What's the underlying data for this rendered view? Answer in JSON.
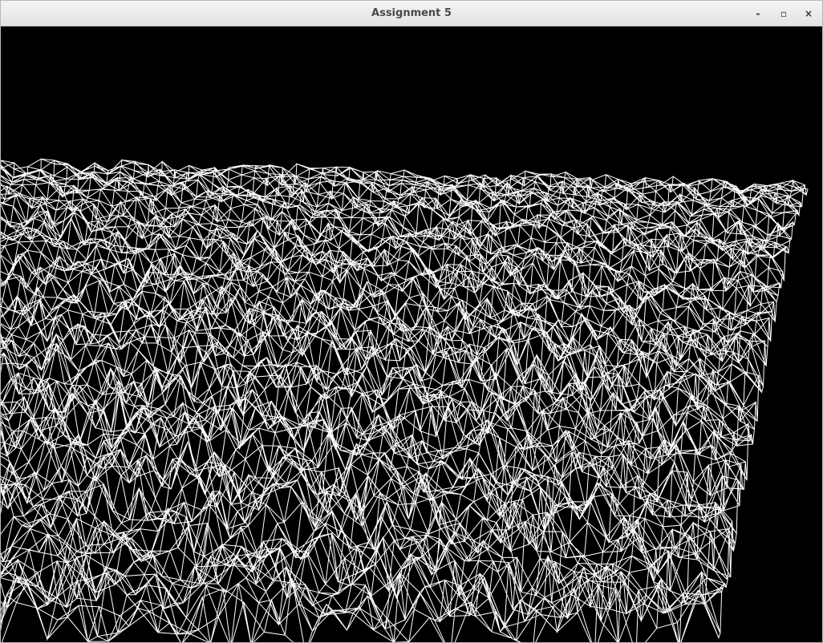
{
  "window": {
    "title": "Assignment 5",
    "controls": {
      "minimize": "-",
      "maximize": "▫",
      "close": "×"
    }
  },
  "viewport": {
    "background": "#000000",
    "line_color": "#ffffff",
    "render_mode": "wireframe terrain"
  }
}
